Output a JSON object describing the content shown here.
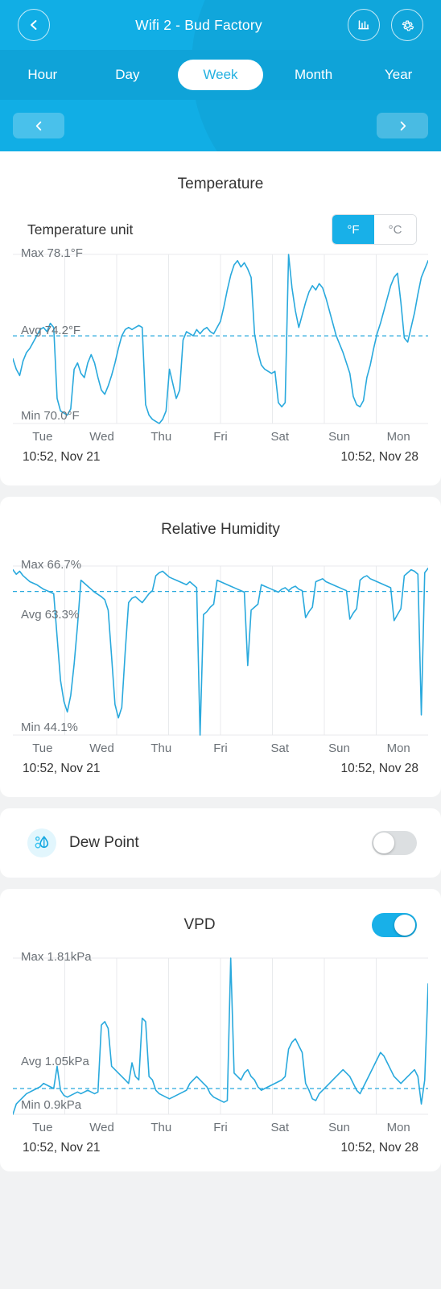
{
  "header": {
    "title": "Wifi 2 - Bud Factory",
    "back_icon": "chevron-left-icon",
    "stats_icon": "bar-chart-icon",
    "settings_icon": "gear-icon",
    "prev_icon": "chevron-left-icon",
    "next_icon": "chevron-right-icon",
    "tabs": [
      {
        "label": "Hour",
        "active": false
      },
      {
        "label": "Day",
        "active": false
      },
      {
        "label": "Week",
        "active": true
      },
      {
        "label": "Month",
        "active": false
      },
      {
        "label": "Year",
        "active": false
      }
    ]
  },
  "colors": {
    "header_blue": "#11aee5",
    "tabbar_blue": "#0fa3d8",
    "accent": "#18b0e8",
    "line": "#29a9dd",
    "grid": "#e8eaec",
    "text": "#333333",
    "muted": "#6b7177"
  },
  "temperature": {
    "title": "Temperature",
    "unit_label": "Temperature unit",
    "unit_options": [
      "°F",
      "°C"
    ],
    "unit_selected": "°F",
    "max_label": "Max 78.1°F",
    "avg_label": "Avg 74.2°F",
    "min_label": "Min 70.0°F",
    "range_start": "10:52,  Nov 21",
    "range_end": "10:52,  Nov 28"
  },
  "humidity": {
    "title": "Relative Humidity",
    "max_label": "Max 66.7%",
    "avg_label": "Avg 63.3%",
    "min_label": "Min 44.1%",
    "range_start": "10:52,  Nov 21",
    "range_end": "10:52,  Nov 28"
  },
  "dew_point": {
    "label": "Dew Point",
    "icon": "dew-drop-icon",
    "enabled": false
  },
  "vpd": {
    "title": "VPD",
    "enabled": true,
    "max_label": "Max 1.81kPa",
    "avg_label": "Avg 1.05kPa",
    "min_label": "Min 0.9kPa",
    "range_start": "10:52,  Nov 21",
    "range_end": "10:52,  Nov 28"
  },
  "axis_days": [
    "Tue",
    "Wed",
    "Thu",
    "Fri",
    "Sat",
    "Sun",
    "Mon"
  ],
  "chart_data": [
    {
      "type": "line",
      "title": "Temperature",
      "xlabel": "",
      "ylabel": "°F",
      "unit": "°F",
      "categories": [
        "Tue",
        "Wed",
        "Thu",
        "Fri",
        "Sat",
        "Sun",
        "Mon"
      ],
      "x_range": [
        "10:52, Nov 21",
        "10:52, Nov 28"
      ],
      "ylim": [
        70.0,
        78.1
      ],
      "max": 78.1,
      "avg": 74.2,
      "min": 70.0,
      "grid": true,
      "avg_line": true,
      "legend": "none",
      "values": [
        73.1,
        72.6,
        72.3,
        73.0,
        73.4,
        73.6,
        73.9,
        74.2,
        74.5,
        74.6,
        74.4,
        74.8,
        74.6,
        71.2,
        70.6,
        70.5,
        70.4,
        70.7,
        72.6,
        72.9,
        72.4,
        72.2,
        72.9,
        73.3,
        72.9,
        72.2,
        71.6,
        71.4,
        71.8,
        72.3,
        72.9,
        73.6,
        74.2,
        74.5,
        74.6,
        74.5,
        74.6,
        74.7,
        74.6,
        70.9,
        70.4,
        70.2,
        70.1,
        70.0,
        70.2,
        70.6,
        72.6,
        71.9,
        71.2,
        71.6,
        74.0,
        74.4,
        74.3,
        74.2,
        74.5,
        74.3,
        74.5,
        74.6,
        74.4,
        74.3,
        74.6,
        74.9,
        75.6,
        76.4,
        77.1,
        77.6,
        77.8,
        77.5,
        77.7,
        77.4,
        77.0,
        74.3,
        73.4,
        72.8,
        72.6,
        72.5,
        72.4,
        72.5,
        71.0,
        70.8,
        71.0,
        78.1,
        76.5,
        75.4,
        74.6,
        75.2,
        75.8,
        76.3,
        76.6,
        76.4,
        76.7,
        76.5,
        76.0,
        75.4,
        74.8,
        74.2,
        73.8,
        73.4,
        72.9,
        72.4,
        71.3,
        70.9,
        70.8,
        71.1,
        72.2,
        72.8,
        73.6,
        74.3,
        74.8,
        75.4,
        76.0,
        76.6,
        77.0,
        77.2,
        75.8,
        74.1,
        73.9,
        74.6,
        75.3,
        76.2,
        77.0,
        77.4,
        77.8
      ]
    },
    {
      "type": "line",
      "title": "Relative Humidity",
      "xlabel": "",
      "ylabel": "%",
      "unit": "%",
      "categories": [
        "Tue",
        "Wed",
        "Thu",
        "Fri",
        "Sat",
        "Sun",
        "Mon"
      ],
      "x_range": [
        "10:52, Nov 21",
        "10:52, Nov 28"
      ],
      "ylim": [
        44.1,
        66.7
      ],
      "max": 66.7,
      "avg": 63.3,
      "min": 44.1,
      "grid": true,
      "avg_line": true,
      "legend": "none",
      "values": [
        66.2,
        65.6,
        66.0,
        65.4,
        65.0,
        64.6,
        64.4,
        64.2,
        63.9,
        63.6,
        63.4,
        63.2,
        63.0,
        57.2,
        51.4,
        48.6,
        47.2,
        49.4,
        53.6,
        58.8,
        64.8,
        64.4,
        64.0,
        63.6,
        63.2,
        62.9,
        62.6,
        62.2,
        60.8,
        54.6,
        48.2,
        46.4,
        47.8,
        55.2,
        61.8,
        62.4,
        62.6,
        62.2,
        61.8,
        62.4,
        63.0,
        63.4,
        65.4,
        65.8,
        66.0,
        65.6,
        65.2,
        65.0,
        64.8,
        64.6,
        64.4,
        64.2,
        64.6,
        64.2,
        63.8,
        44.1,
        60.2,
        60.6,
        61.2,
        61.6,
        64.8,
        64.6,
        64.4,
        64.2,
        64.0,
        63.8,
        63.6,
        63.4,
        63.2,
        53.4,
        60.8,
        61.2,
        61.6,
        64.2,
        64.0,
        63.8,
        63.6,
        63.4,
        63.2,
        63.6,
        63.8,
        63.4,
        63.8,
        64.0,
        63.6,
        63.4,
        59.8,
        60.6,
        61.2,
        64.6,
        64.8,
        65.0,
        64.6,
        64.4,
        64.2,
        64.0,
        63.8,
        63.6,
        63.4,
        59.6,
        60.4,
        61.0,
        64.8,
        65.2,
        65.4,
        65.0,
        64.8,
        64.6,
        64.4,
        64.2,
        64.0,
        63.8,
        59.4,
        60.2,
        61.0,
        65.4,
        65.8,
        66.2,
        66.0,
        65.6,
        46.8,
        65.8,
        66.4
      ]
    },
    {
      "type": "line",
      "title": "VPD",
      "xlabel": "",
      "ylabel": "kPa",
      "unit": "kPa",
      "categories": [
        "Tue",
        "Wed",
        "Thu",
        "Fri",
        "Sat",
        "Sun",
        "Mon"
      ],
      "x_range": [
        "10:52, Nov 21",
        "10:52, Nov 28"
      ],
      "ylim": [
        0.9,
        1.81
      ],
      "max": 1.81,
      "avg": 1.05,
      "min": 0.9,
      "grid": true,
      "avg_line": true,
      "legend": "none",
      "values": [
        0.9,
        0.96,
        0.98,
        1.0,
        1.02,
        1.03,
        1.04,
        1.05,
        1.06,
        1.08,
        1.07,
        1.06,
        1.05,
        1.18,
        1.04,
        1.01,
        1.0,
        1.01,
        1.02,
        1.03,
        1.02,
        1.03,
        1.04,
        1.03,
        1.02,
        1.03,
        1.42,
        1.44,
        1.4,
        1.18,
        1.16,
        1.14,
        1.12,
        1.1,
        1.08,
        1.2,
        1.12,
        1.1,
        1.46,
        1.44,
        1.12,
        1.1,
        1.04,
        1.02,
        1.01,
        1.0,
        0.99,
        1.0,
        1.01,
        1.02,
        1.03,
        1.04,
        1.08,
        1.1,
        1.12,
        1.1,
        1.08,
        1.06,
        1.02,
        1.0,
        0.99,
        0.98,
        0.97,
        0.98,
        1.81,
        1.14,
        1.12,
        1.1,
        1.14,
        1.16,
        1.12,
        1.1,
        1.06,
        1.04,
        1.05,
        1.06,
        1.07,
        1.08,
        1.09,
        1.1,
        1.12,
        1.28,
        1.32,
        1.34,
        1.3,
        1.26,
        1.08,
        1.04,
        0.99,
        0.98,
        1.02,
        1.04,
        1.06,
        1.08,
        1.1,
        1.12,
        1.14,
        1.16,
        1.14,
        1.12,
        1.08,
        1.04,
        1.02,
        1.06,
        1.1,
        1.14,
        1.18,
        1.22,
        1.26,
        1.24,
        1.2,
        1.16,
        1.12,
        1.1,
        1.08,
        1.1,
        1.12,
        1.14,
        1.16,
        1.12,
        0.96,
        1.1,
        1.66
      ]
    }
  ]
}
